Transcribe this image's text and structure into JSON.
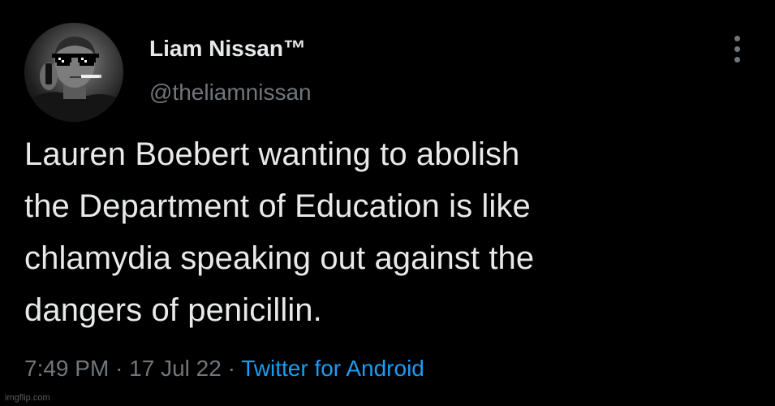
{
  "author": {
    "display_name": "Liam Nissan™",
    "handle": "@theliamnissan",
    "avatar_icon": "profile-photo-with-pixel-sunglasses"
  },
  "tweet": {
    "text": "Lauren Boebert wanting to abolish\nthe Department of Education is like\nchlamydia speaking out against the\ndangers of penicillin.",
    "time": "7:49 PM",
    "separator": "·",
    "date": "17 Jul 22",
    "source": "Twitter for Android"
  },
  "menu": {
    "icon": "more-vertical-icon"
  },
  "watermark": {
    "text": "imgflip.com"
  },
  "colors": {
    "background": "#000000",
    "primary_text": "#e7e9ea",
    "secondary_text": "#71767b",
    "link": "#1d9bf0"
  }
}
